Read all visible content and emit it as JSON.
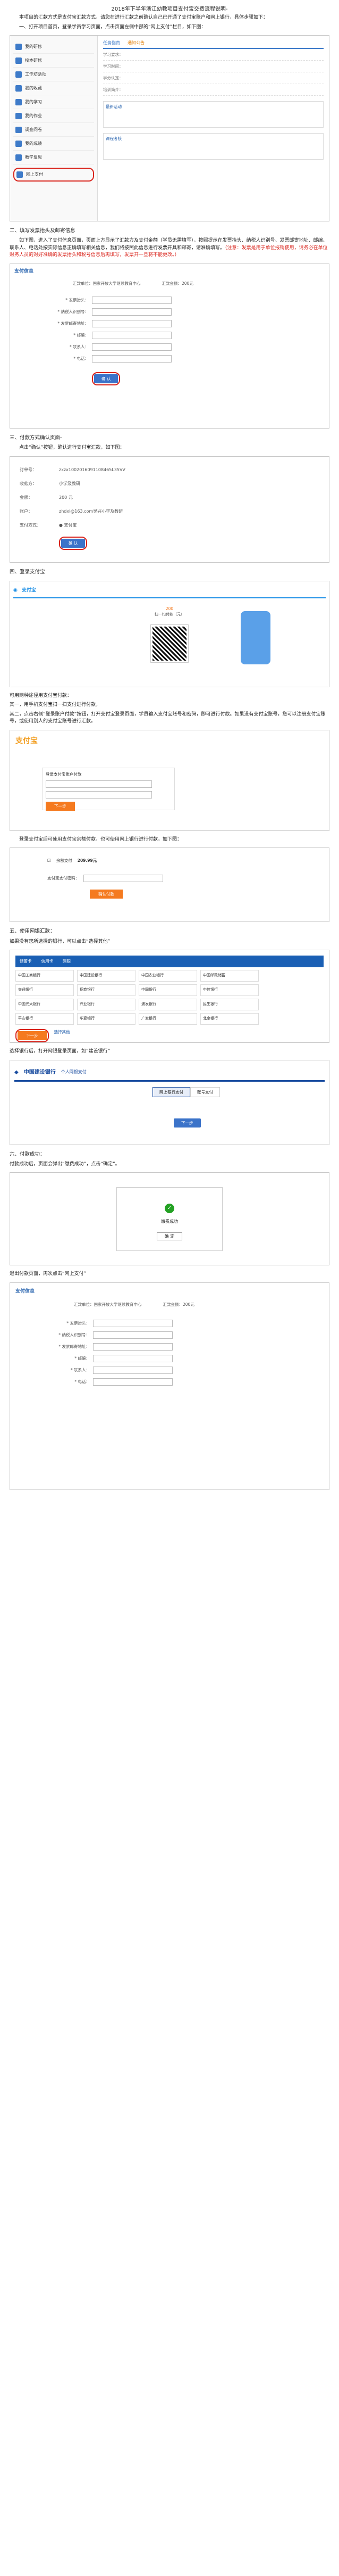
{
  "doc": {
    "title": "2018年下半年浙江幼教项目支付宝交费流程说明-",
    "intro": "本项目的汇款方式是支付宝汇款方式，请您在进行汇款之前确认自己已开通了支付宝账户和网上银行，具体步骤如下：",
    "step1": "一、打开项目首页，登录学员学习页面，点击页面左侧中部的“网上支付”栏目，如下图：",
    "step2_title": "二、填写发票抬头及邮寄信息",
    "step2_body_a": "如下图，进入了支付信息页面，页面上方显示了汇款方及支付金额（学员无需填写），按照提示在发票抬头、纳税人识别号、发票邮寄地址、邮编、联系人、电话处按实际信息正确填写相关信息，我们将按照此信息进行发票开具和邮寄，请准确填写。",
    "step2_body_red": "（注意：发票是用于单位报销使用，请务必在单位财务人员的对好准确的发票抬头和税号信息后再填写，发票开一旦将不能更改。）",
    "step3": "三、付款方式确认页面-",
    "step3_b": "点击“确认”按钮，确认进行支付宝汇款，如下图：",
    "step4": "四、登录支付宝",
    "step4_a": "可用两种途径用支付宝付款：",
    "step4_b": "其一，用手机支付宝扫一扫支付进行付款。",
    "step4_c": "其二，点击右侧“登录账户付款”按钮，打开支付宝登录页面，学员输入支付宝账号和密码，即可进行付款。如果没有支付宝账号，您可以注册支付宝账号，或使用别人的支付宝账号进行汇款。",
    "step4_d": "登录支付宝后可使用支付宝余额付款，也可使用网上银行进行付款，如下图：",
    "step5": "五、使用网银汇款：",
    "step5_a": "如果没有您所选择的银行，可以点击“选择其他”",
    "step5_b": "选择银行后，打开网银登录页面，如“建设银行”",
    "step6": "六、付款成功：",
    "step6_a": "付款成功后，页面会弹出“缴费成功”，点击“确定”。",
    "step6_b": "退出付款页面，再次点击“网上支付”"
  },
  "portal": {
    "menu": [
      "我的研修",
      "校本研修",
      "工作坊活动",
      "我的收藏",
      "我的学习",
      "我的作业",
      "调查问卷",
      "我的成绩",
      "教学反思",
      "网上支付"
    ],
    "tabs": [
      "任务指南",
      "通知公告"
    ],
    "rows": [
      "学习要求：",
      "学习时间：",
      "学分认定：",
      "培训简介："
    ],
    "boxes": [
      "最新活动",
      "课程考核"
    ]
  },
  "form": {
    "brand": "支付信息",
    "payer_label": "汇款单位：国家开放大学继续教育中心",
    "amount_label": "汇款金额：200元",
    "fields": [
      "* 发票抬头：",
      "* 纳税人识别号：",
      "* 发票邮寄地址：",
      "* 邮编：",
      "* 联系人：",
      "* 电话："
    ],
    "confirm": "确 认"
  },
  "payment": {
    "order_k": "订单号：",
    "order_v": "zxzx1002016091108465L35VV",
    "org_k": "收款方：",
    "org_v": "小学及教研",
    "amount_k": "金额：",
    "amount_v": "200 元",
    "account_k": "账户：",
    "account_v": "zhdxl@163.com吴兴小学及教研",
    "method_k": "支付方式：",
    "method_v": "● 支付宝",
    "confirm": "确 认"
  },
  "alipay": {
    "brand": "支付宝",
    "amount": "200",
    "scan_text": "扫一扫付款（元）",
    "login_brand": "支付宝",
    "login_title": "登录支付宝账户付款",
    "login_btn": "下一步",
    "balance_label": "余额支付",
    "balance_amount": "209.99元",
    "pay_pwd_label": "支付宝支付密码：",
    "confirm_pay": "确认付款",
    "other_methods": "其他付款方式"
  },
  "banks": {
    "tabs": [
      "储蓄卡",
      "信用卡",
      "网银"
    ],
    "items": [
      "中国工商银行",
      "中国建设银行",
      "中国农业银行",
      "中国邮政储蓄",
      "交通银行",
      "招商银行",
      "中国银行",
      "中信银行",
      "中国光大银行",
      "兴业银行",
      "浦发银行",
      "民生银行",
      "平安银行",
      "华夏银行",
      "广发银行",
      "北京银行"
    ],
    "next": "下一步",
    "select_other": "选择其他"
  },
  "ccb": {
    "brand": "中国建设银行",
    "sub": "个人网银支付",
    "tabs": [
      "网上银行支付",
      "账号支付"
    ],
    "pay_btn": "下一步"
  },
  "success": {
    "title": "缴费成功",
    "ok": "确 定"
  },
  "final_form": {
    "brand": "支付信息",
    "payer_label": "汇款单位：国家开放大学继续教育中心",
    "amount_label": "汇款金额：200元",
    "fields": [
      "* 发票抬头：",
      "* 纳税人识别号：",
      "* 发票邮寄地址：",
      "* 邮编：",
      "* 联系人：",
      "* 电话："
    ],
    "confirm": "确 认"
  }
}
